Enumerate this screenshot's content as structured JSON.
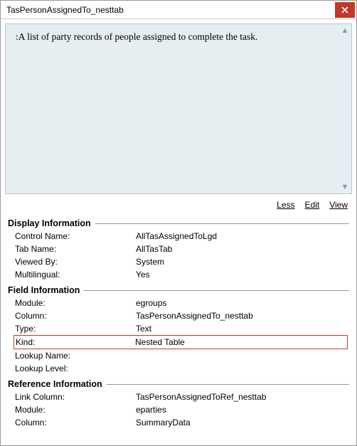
{
  "window": {
    "title": "TasPersonAssignedTo_nesttab",
    "close_icon": "close"
  },
  "description": ":A list of party records of people assigned to complete the task.",
  "toolbar": {
    "less": "Less",
    "edit": "Edit",
    "view": "View"
  },
  "sections": {
    "display": {
      "header": "Display Information",
      "rows": {
        "control_name": {
          "label": "Control Name:",
          "value": "AllTasAssignedToLgd"
        },
        "tab_name": {
          "label": "Tab Name:",
          "value": "AllTasTab"
        },
        "viewed_by": {
          "label": "Viewed By:",
          "value": "System"
        },
        "multilingual": {
          "label": "Multilingual:",
          "value": "Yes"
        }
      }
    },
    "field": {
      "header": "Field Information",
      "rows": {
        "module": {
          "label": "Module:",
          "value": "egroups"
        },
        "column": {
          "label": "Column:",
          "value": "TasPersonAssignedTo_nesttab"
        },
        "type": {
          "label": "Type:",
          "value": "Text"
        },
        "kind": {
          "label": "Kind:",
          "value": "Nested Table"
        },
        "lookup_name": {
          "label": "Lookup Name:",
          "value": ""
        },
        "lookup_level": {
          "label": "Lookup Level:",
          "value": ""
        }
      }
    },
    "reference": {
      "header": "Reference Information",
      "rows": {
        "link_column": {
          "label": "Link Column:",
          "value": "TasPersonAssignedToRef_nesttab"
        },
        "module": {
          "label": "Module:",
          "value": "eparties"
        },
        "column": {
          "label": "Column:",
          "value": "SummaryData"
        }
      }
    }
  }
}
